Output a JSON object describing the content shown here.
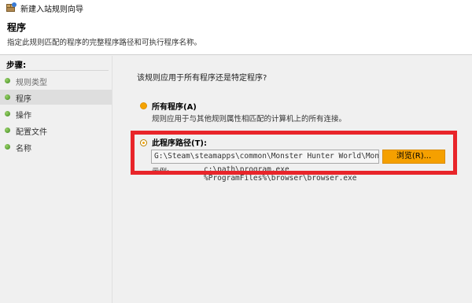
{
  "window": {
    "title": "新建入站规则向导"
  },
  "header": {
    "heading": "程序",
    "description": "指定此规则匹配的程序的完整程序路径和可执行程序名称。"
  },
  "sidebar": {
    "title": "步骤:",
    "items": [
      {
        "label": "规则类型"
      },
      {
        "label": "程序"
      },
      {
        "label": "操作"
      },
      {
        "label": "配置文件"
      },
      {
        "label": "名称"
      }
    ]
  },
  "main": {
    "question": "该规则应用于所有程序还是特定程序?",
    "all_programs": {
      "label": "所有程序(A)",
      "description": "规则应用于与其他规则属性相匹配的计算机上的所有连接。"
    },
    "this_program": {
      "label": "此程序路径(T):",
      "path_value": "G:\\Steam\\steamapps\\common\\Monster Hunter World\\MonsterHu",
      "browse_label": "浏览(R)...",
      "example_label": "示例:",
      "example_lines": [
        "c:\\path\\program.exe",
        "%ProgramFiles%\\browser\\browser.exe"
      ]
    }
  },
  "colors": {
    "accent": "#f5a000",
    "highlight_box": "#e8252a",
    "step_dot": "#4a9a24"
  }
}
